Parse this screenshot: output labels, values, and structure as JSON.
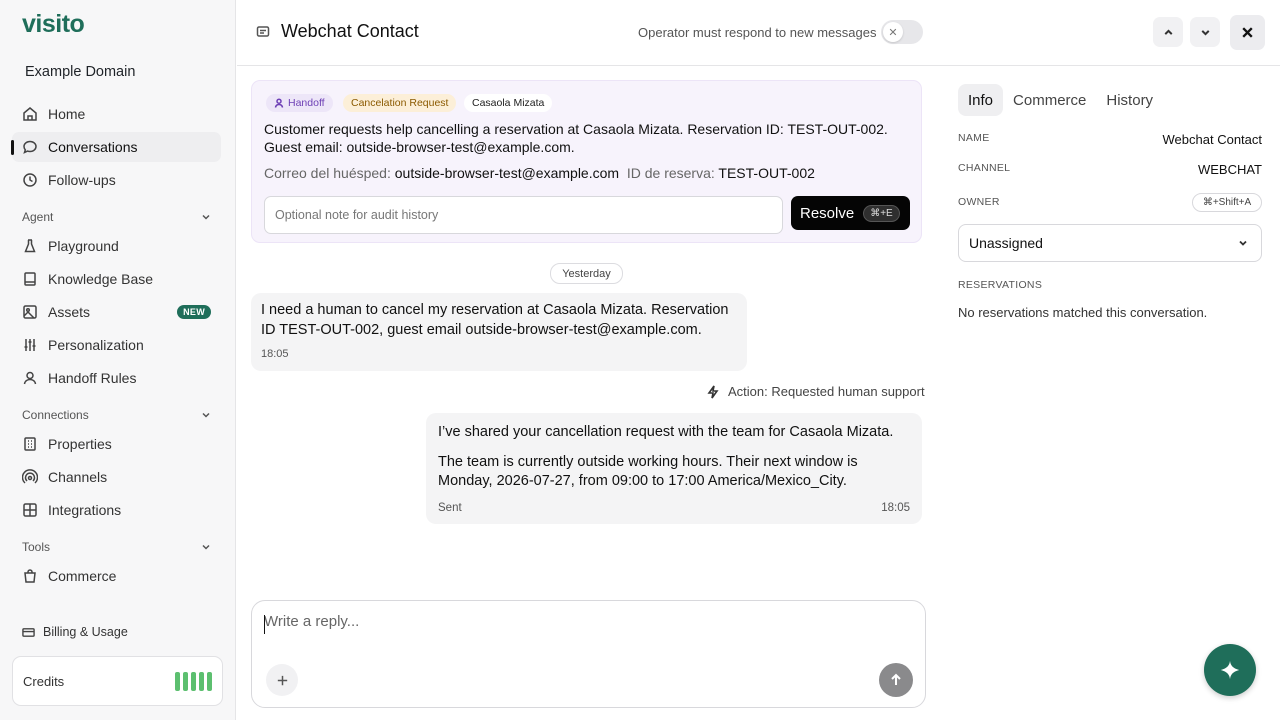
{
  "brand": {
    "logo": "visito",
    "domain": "Example Domain",
    "accent": "#1f6e5a"
  },
  "sidebar": {
    "items": [
      {
        "label": "Home",
        "icon": "home-icon"
      },
      {
        "label": "Conversations",
        "icon": "chat-icon",
        "active": true
      },
      {
        "label": "Follow-ups",
        "icon": "clock-icon"
      },
      {
        "label": "Playground",
        "icon": "flask-icon"
      },
      {
        "label": "Knowledge Base",
        "icon": "book-icon"
      },
      {
        "label": "Assets",
        "icon": "image-icon",
        "badge": "NEW"
      },
      {
        "label": "Personalization",
        "icon": "sliders-icon"
      },
      {
        "label": "Handoff Rules",
        "icon": "user-icon"
      },
      {
        "label": "Properties",
        "icon": "building-icon"
      },
      {
        "label": "Channels",
        "icon": "broadcast-icon"
      },
      {
        "label": "Integrations",
        "icon": "puzzle-icon"
      },
      {
        "label": "Commerce",
        "icon": "bag-icon"
      }
    ],
    "sections": {
      "agent": "Agent",
      "connections": "Connections",
      "tools": "Tools"
    },
    "billing": "Billing & Usage",
    "credits": "Credits"
  },
  "header": {
    "title": "Webchat Contact",
    "operator_text": "Operator must respond to new messages",
    "operator_toggle": "off"
  },
  "handoff": {
    "tags": {
      "handoff": "Handoff",
      "reason": "Cancelation Request",
      "property": "Casaola Mizata"
    },
    "summary": "Customer requests help cancelling a reservation at Casaola Mizata. Reservation ID: TEST-OUT-002. Guest email: outside-browser-test@example.com.",
    "email_label": "Correo del huésped:",
    "email_value": "outside-browser-test@example.com",
    "reservation_label": "ID de reserva:",
    "reservation_value": "TEST-OUT-002",
    "note_placeholder": "Optional note for audit history",
    "resolve_label": "Resolve",
    "resolve_shortcut": "⌘+E"
  },
  "conversation": {
    "date_divider": "Yesterday",
    "incoming": {
      "text": "I need a human to cancel my reservation at Casaola Mizata. Reservation ID TEST-OUT-002, guest email outside-browser-test@example.com.",
      "time": "18:05"
    },
    "action": "Action: Requested human support",
    "outgoing": {
      "p1": "I’ve shared your cancellation request with the team for Casaola Mizata.",
      "p2": "The team is currently outside working hours. Their next window is Monday, 2026-07-27, from 09:00 to 17:00 America/Mexico_City.",
      "status": "Sent",
      "time": "18:05"
    }
  },
  "composer": {
    "placeholder": "Write a reply..."
  },
  "panel": {
    "tabs": [
      "Info",
      "Commerce",
      "History"
    ],
    "name_label": "NAME",
    "name_value": "Webchat Contact",
    "channel_label": "CHANNEL",
    "channel_value": "WEBCHAT",
    "owner_label": "OWNER",
    "owner_shortcut": "⌘+Shift+A",
    "owner_value": "Unassigned",
    "reservations_label": "RESERVATIONS",
    "reservations_empty": "No reservations matched this conversation."
  }
}
